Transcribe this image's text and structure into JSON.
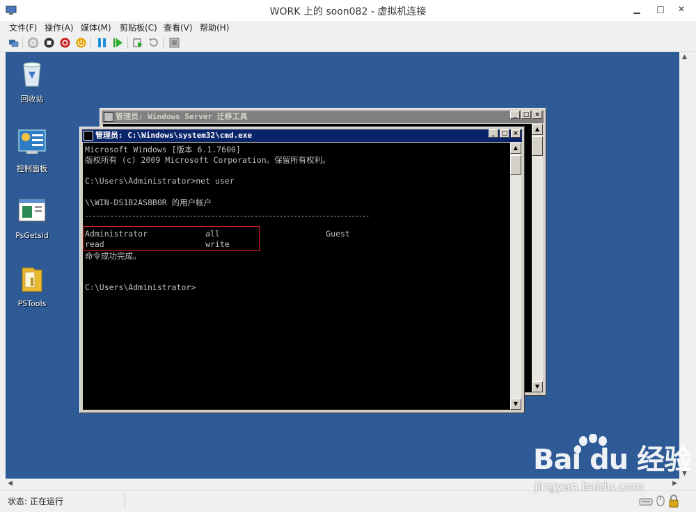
{
  "window": {
    "title": "WORK 上的 soon082 - 虚拟机连接",
    "controls": {
      "minimize": "▁",
      "maximize": "□",
      "close": "✕"
    }
  },
  "menu": {
    "items": [
      "文件(F)",
      "操作(A)",
      "媒体(M)",
      "剪贴板(C)",
      "查看(V)",
      "帮助(H)"
    ]
  },
  "toolbar": {
    "icons": [
      "ctrl-alt-del-icon",
      "start-icon",
      "turn-off-icon",
      "shutdown-icon",
      "save-icon",
      "pause-icon",
      "reset-icon",
      "snapshot-icon",
      "revert-icon",
      "enhanced-session-icon"
    ]
  },
  "desktop": {
    "icons": [
      {
        "label": "回收站",
        "icon": "recycle-bin-icon"
      },
      {
        "label": "控制面板",
        "icon": "control-panel-icon"
      },
      {
        "label": "PsGetsid",
        "icon": "application-icon"
      },
      {
        "label": "PSTools",
        "icon": "folder-icon"
      }
    ]
  },
  "back_window": {
    "title": "管理员: Windows Server 迁移工具"
  },
  "cmd_window": {
    "title": "管理员: C:\\Windows\\system32\\cmd.exe",
    "lines": [
      "Microsoft Windows [版本 6.1.7600]",
      "版权所有 (c) 2009 Microsoft Corporation。保留所有权利。",
      "",
      "C:\\Users\\Administrator>net user",
      "",
      "\\\\WIN-DS1B2AS8B0R 的用户帐户",
      "",
      "-------------------------------------------------------------------------------",
      "Administrator            all                      Guest",
      "read                     write",
      "命令成功完成。",
      "",
      "",
      "C:\\Users\\Administrator>"
    ]
  },
  "status": {
    "text": "状态: 正在运行"
  },
  "watermark": {
    "brand": "Bai du 经验",
    "url": "jingyan.baidu.com"
  },
  "colors": {
    "desktop": "#2e5a95",
    "highlight": "#e0242b",
    "active_title": "#0a246a"
  }
}
